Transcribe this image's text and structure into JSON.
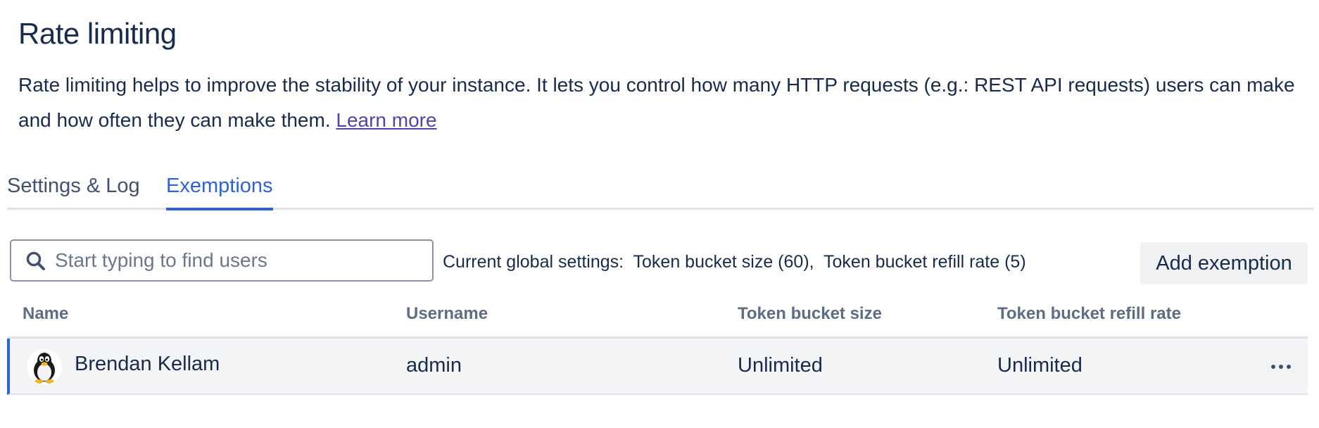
{
  "page": {
    "title": "Rate limiting",
    "description": "Rate limiting helps to improve the stability of your instance. It lets you control how many HTTP requests (e.g.: REST API requests) users can make and how often they can make them.",
    "learn_more": "Learn more"
  },
  "tabs": [
    {
      "label": "Settings & Log",
      "active": false
    },
    {
      "label": "Exemptions",
      "active": true
    }
  ],
  "search": {
    "placeholder": "Start typing to find users",
    "value": ""
  },
  "global_settings": "Current global settings:  Token bucket size (60),  Token bucket refill rate (5)",
  "add_exemption_label": "Add exemption",
  "table": {
    "columns": [
      "Name",
      "Username",
      "Token bucket size",
      "Token bucket refill rate"
    ],
    "rows": [
      {
        "name": "Brendan Kellam",
        "username": "admin",
        "token_bucket_size": "Unlimited",
        "token_bucket_refill_rate": "Unlimited",
        "avatar": "penguin-avatar"
      }
    ]
  },
  "colors": {
    "accent": "#2f62d9",
    "link": "#5243aa",
    "text": "#172b4d",
    "row_background": "#f3f4f6"
  }
}
